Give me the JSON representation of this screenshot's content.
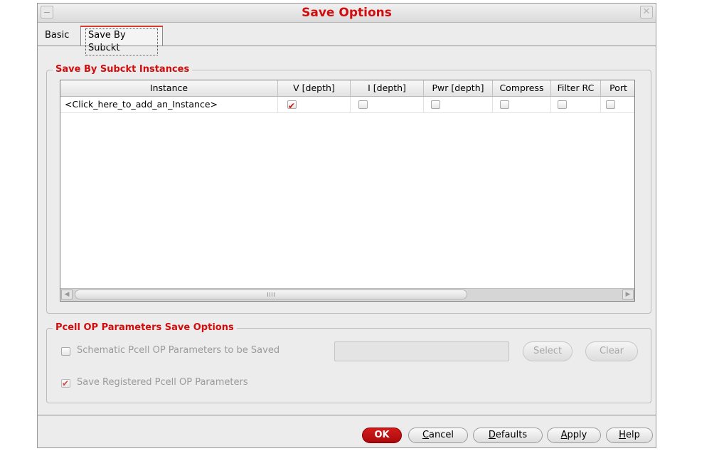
{
  "window": {
    "title": "Save Options",
    "close_glyph": "✕"
  },
  "tabs": [
    {
      "label": "Basic"
    },
    {
      "label": "Save By Subckt"
    }
  ],
  "instances_group": {
    "title": "Save By Subckt Instances",
    "columns": [
      "Instance",
      "V [depth]",
      "I [depth]",
      "Pwr [depth]",
      "Compress",
      "Filter RC",
      "Port"
    ],
    "rows": [
      {
        "instance": "<Click_here_to_add_an_Instance>",
        "v": true,
        "i": false,
        "pwr": false,
        "compress": false,
        "filter_rc": false,
        "port": false
      }
    ],
    "scroll_grip": "III"
  },
  "pcell_group": {
    "title": "Pcell OP Parameters Save Options",
    "schematic_label": "Schematic Pcell OP Parameters to be Saved",
    "schematic_checked": false,
    "registered_label": "Save Registered Pcell OP Parameters",
    "registered_checked": true,
    "select_label": "Select",
    "clear_label": "Clear"
  },
  "footer": {
    "ok": "OK",
    "cancel_rest": "ancel",
    "cancel_first": "C",
    "defaults_first": "D",
    "defaults_rest": "efaults",
    "apply_first": "A",
    "apply_rest": "pply",
    "help_first": "H",
    "help_rest": "elp"
  },
  "colors": {
    "accent": "#d30d0d",
    "ok_button": "#c01212"
  }
}
